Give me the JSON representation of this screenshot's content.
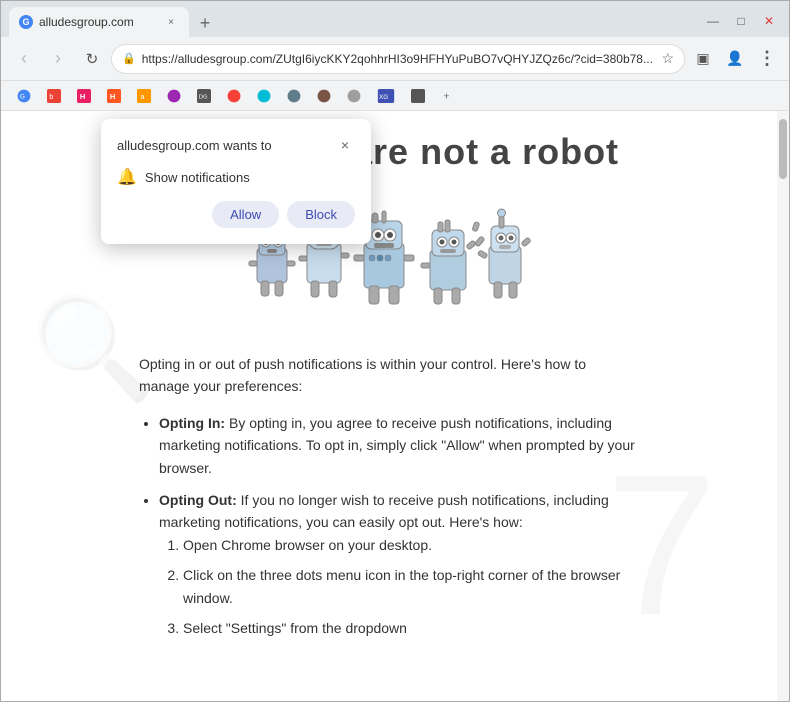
{
  "browser": {
    "tab": {
      "favicon": "G",
      "title": "alludesgroup.com",
      "close": "×"
    },
    "nav": {
      "back": "‹",
      "forward": "›",
      "refresh": "↻"
    },
    "address": {
      "lock": "🔒",
      "url": "https://alludesgroup.com/ZUtgI6iycKKY2qohhrHI3o9HFHYuPuBO7vQHYJZQz6c/?cid=380b78...",
      "star": "☆"
    },
    "toolbar_icons": {
      "profile": "👤",
      "extension": "⊞",
      "menu": "⋮",
      "sidebar": "▣",
      "minimize": "—",
      "maximize": "□",
      "close": "×"
    }
  },
  "bookmarks": [
    {
      "label": "",
      "icon": "G",
      "color": "#4285f4"
    },
    {
      "label": "",
      "icon": "🔖",
      "color": "#ea4335"
    },
    {
      "label": "H",
      "icon": "H",
      "color": "#e91e63"
    },
    {
      "label": "",
      "icon": "H",
      "color": "#ff5722"
    },
    {
      "label": "",
      "icon": "a",
      "color": "#ff9800"
    },
    {
      "label": "",
      "icon": "◉",
      "color": "#9c27b0"
    },
    {
      "label": "DG",
      "icon": "DG",
      "color": "#4caf50"
    },
    {
      "label": "",
      "icon": "🔖",
      "color": "#f44336"
    },
    {
      "label": "",
      "icon": "◎",
      "color": "#00bcd4"
    },
    {
      "label": "",
      "icon": "◉",
      "color": "#607d8b"
    },
    {
      "label": "",
      "icon": "◉",
      "color": "#795548"
    },
    {
      "label": "",
      "icon": "◉",
      "color": "#9e9e9e"
    },
    {
      "label": "XG",
      "icon": "XG",
      "color": "#3f51b5"
    },
    {
      "label": "",
      "icon": "▣",
      "color": "#555"
    },
    {
      "label": "+",
      "icon": "+",
      "color": "#666"
    }
  ],
  "popup": {
    "title": "alludesgroup.com wants to",
    "close_label": "×",
    "notification_icon": "🔔",
    "notification_text": "Show notifications",
    "allow_button": "Allow",
    "block_button": "Block"
  },
  "page": {
    "heading": "Verify you are not   a robot",
    "body_intro": "Opting in or out of push notifications is within your control. Here's how to manage your preferences:",
    "bullet1_title": "Opting In:",
    "bullet1_text": " By opting in, you agree to receive push notifications, including marketing notifications. To opt in, simply click \"Allow\" when prompted by your browser.",
    "bullet2_title": "Opting Out:",
    "bullet2_text": " If you no longer wish to receive push notifications, including marketing notifications, you can easily opt out. Here's how:",
    "steps": [
      "Open Chrome browser on your desktop.",
      "Click on the three dots menu icon in the top-right corner of the browser window.",
      "Select \"Settings\" from the dropdown"
    ]
  },
  "colors": {
    "accent_blue": "#5c6bc0",
    "tab_bg": "#f1f3f4",
    "bar_bg": "#dee3e8",
    "popup_btn_bg": "#e8eaf6",
    "popup_btn_text": "#3c4db1"
  }
}
